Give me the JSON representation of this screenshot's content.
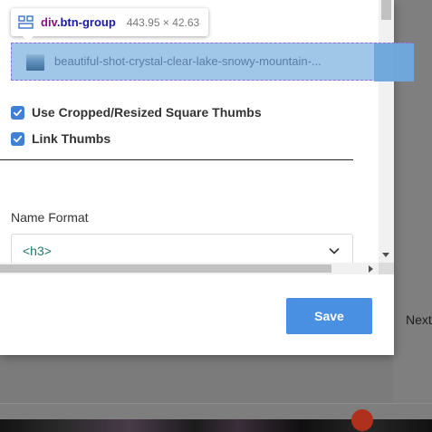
{
  "tooltip": {
    "tag": "div",
    "class_name": ".btn-group",
    "dimensions": "443.95 × 42.63",
    "icon": "grid-layout-icon"
  },
  "thumbnail": {
    "filename": "beautiful-shot-crystal-clear-lake-snowy-mountain-...",
    "icon": "image-thumbnail-icon"
  },
  "options": [
    {
      "label": "Use Cropped/Resized Square Thumbs",
      "checked": true
    },
    {
      "label": "Link Thumbs",
      "checked": true
    }
  ],
  "name_format": {
    "label": "Name Format",
    "selected": "<h3>",
    "icon": "chevron-down-icon"
  },
  "actions": {
    "save_label": "Save"
  },
  "background": {
    "next_label": "Next"
  },
  "colors": {
    "accent": "#4a90e2",
    "checkbox": "#3f7fd4",
    "highlight": "#6fa8dc",
    "select_text": "#1f7a73"
  }
}
